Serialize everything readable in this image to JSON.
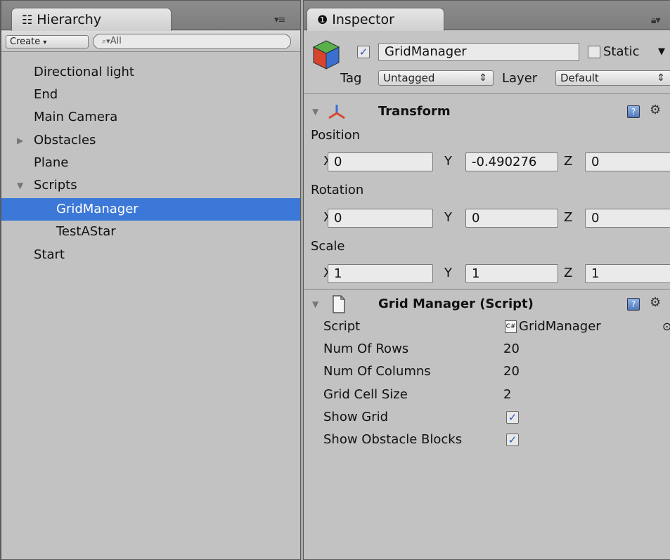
{
  "hierarchy": {
    "tab_label": "Hierarchy",
    "create_label": "Create",
    "search_placeholder": "All",
    "items": [
      {
        "label": "Directional light"
      },
      {
        "label": "End"
      },
      {
        "label": "Main Camera"
      },
      {
        "label": "Obstacles",
        "fold": "collapsed"
      },
      {
        "label": "Plane"
      },
      {
        "label": "Scripts",
        "fold": "expanded"
      },
      {
        "label": "GridManager",
        "selected": true
      },
      {
        "label": "TestAStar"
      },
      {
        "label": "Start"
      }
    ]
  },
  "inspector": {
    "tab_label": "Inspector",
    "object": {
      "active_checked": true,
      "name": "GridManager",
      "static_label": "Static",
      "tag_label": "Tag",
      "tag_value": "Untagged",
      "layer_label": "Layer",
      "layer_value": "Default"
    },
    "transform": {
      "title": "Transform",
      "position_label": "Position",
      "rotation_label": "Rotation",
      "scale_label": "Scale",
      "axis_x": "X",
      "axis_y": "Y",
      "axis_z": "Z",
      "position": {
        "x": "0",
        "y": "-0.490276",
        "z": "0"
      },
      "rotation": {
        "x": "0",
        "y": "0",
        "z": "0"
      },
      "scale": {
        "x": "1",
        "y": "1",
        "z": "1"
      }
    },
    "grid_manager": {
      "title": "Grid Manager (Script)",
      "script_label": "Script",
      "script_value": "GridManager",
      "num_rows_label": "Num Of Rows",
      "num_rows_value": "20",
      "num_cols_label": "Num Of Columns",
      "num_cols_value": "20",
      "cell_size_label": "Grid Cell Size",
      "cell_size_value": "2",
      "show_grid_label": "Show Grid",
      "show_grid_checked": true,
      "show_obstacles_label": "Show Obstacle Blocks",
      "show_obstacles_checked": true
    }
  },
  "colors": {
    "selection": "#3c78d8",
    "panel_bg": "#c2c2c2",
    "tab_bar": "#858585"
  }
}
